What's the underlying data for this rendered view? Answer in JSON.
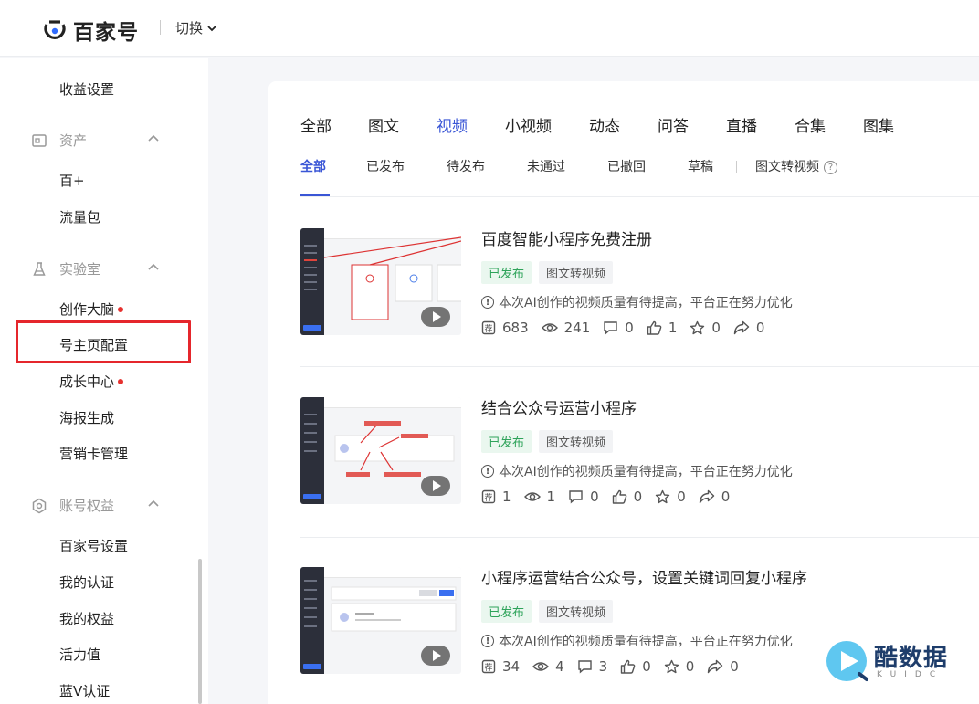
{
  "topbar": {
    "brand": "百家号",
    "switch_label": "切换"
  },
  "sidebar": {
    "income_settings": "收益设置",
    "groups": {
      "assets": {
        "label": "资产",
        "items": [
          "百+",
          "流量包"
        ]
      },
      "lab": {
        "label": "实验室",
        "items": [
          "创作大脑",
          "号主页配置",
          "成长中心",
          "海报生成",
          "营销卡管理"
        ]
      },
      "account": {
        "label": "账号权益",
        "items": [
          "百家号设置",
          "我的认证",
          "我的权益",
          "活力值",
          "蓝V认证"
        ]
      }
    }
  },
  "tabs": [
    "全部",
    "图文",
    "视频",
    "小视频",
    "动态",
    "问答",
    "直播",
    "合集",
    "图集"
  ],
  "active_tab": "视频",
  "subtabs": [
    "全部",
    "已发布",
    "待发布",
    "未通过",
    "已撤回",
    "草稿"
  ],
  "subtab_extra": "图文转视频",
  "help_glyph": "?",
  "items": [
    {
      "title": "百度智能小程序免费注册",
      "tags": [
        "已发布",
        "图文转视频"
      ],
      "notice": "本次AI创作的视频质量有待提高，平台正在努力优化",
      "stats": {
        "rec": "683",
        "views": "241",
        "comments": "0",
        "likes": "1",
        "favs": "0",
        "shares": "0"
      }
    },
    {
      "title": "结合公众号运营小程序",
      "tags": [
        "已发布",
        "图文转视频"
      ],
      "notice": "本次AI创作的视频质量有待提高，平台正在努力优化",
      "stats": {
        "rec": "1",
        "views": "1",
        "comments": "0",
        "likes": "0",
        "favs": "0",
        "shares": "0"
      }
    },
    {
      "title": "小程序运营结合公众号，设置关键词回复小程序",
      "tags": [
        "已发布",
        "图文转视频"
      ],
      "notice": "本次AI创作的视频质量有待提高，平台正在努力优化",
      "stats": {
        "rec": "34",
        "views": "4",
        "comments": "3",
        "likes": "0",
        "favs": "0",
        "shares": "0"
      }
    }
  ],
  "watermark": {
    "name": "酷数据",
    "sub": "KUIDC"
  },
  "colors": {
    "accent": "#3a56d6",
    "published": "#2ea35a",
    "highlight": "#e5262c",
    "dot": "#e6312f"
  }
}
